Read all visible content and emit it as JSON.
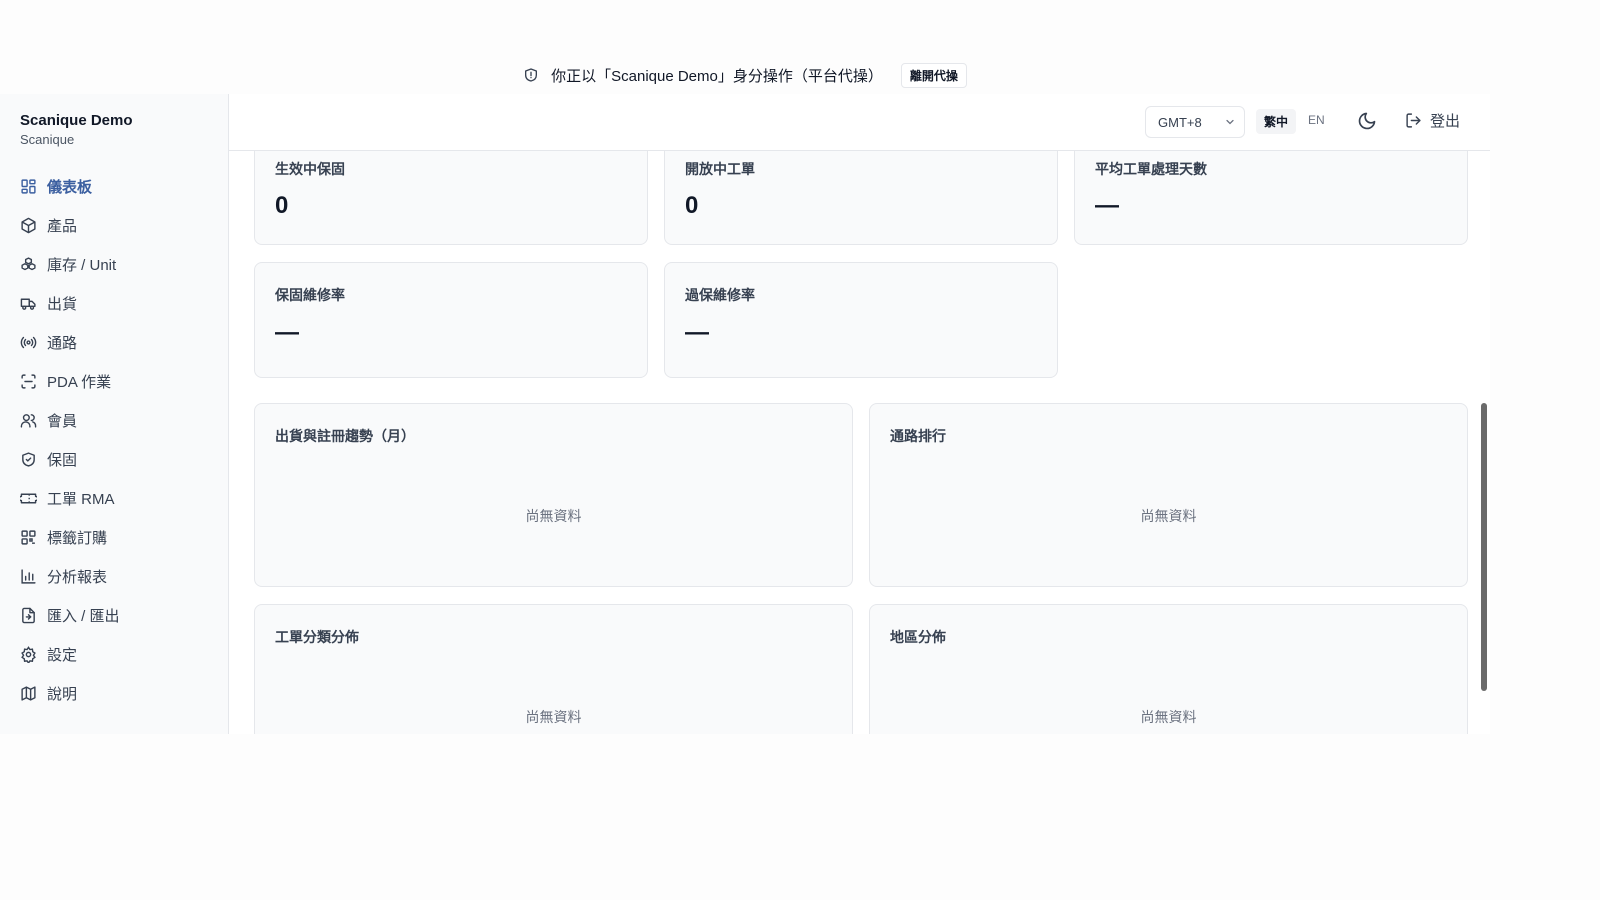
{
  "banner": {
    "text": "你正以「Scanique Demo」身分操作（平台代操）",
    "button_label": "離開代操"
  },
  "sidebar": {
    "brand_name": "Scanique Demo",
    "brand_sub": "Scanique",
    "items": [
      {
        "label": "儀表板",
        "icon": "dashboard-icon"
      },
      {
        "label": "產品",
        "icon": "package-icon"
      },
      {
        "label": "庫存 / Unit",
        "icon": "boxes-icon"
      },
      {
        "label": "出貨",
        "icon": "truck-icon"
      },
      {
        "label": "通路",
        "icon": "radio-icon"
      },
      {
        "label": "PDA 作業",
        "icon": "scan-icon"
      },
      {
        "label": "會員",
        "icon": "users-icon"
      },
      {
        "label": "保固",
        "icon": "shield-check-icon"
      },
      {
        "label": "工單 RMA",
        "icon": "ticket-icon"
      },
      {
        "label": "標籤訂購",
        "icon": "qr-code-icon"
      },
      {
        "label": "分析報表",
        "icon": "bar-chart-icon"
      },
      {
        "label": "匯入 / 匯出",
        "icon": "file-transfer-icon"
      },
      {
        "label": "設定",
        "icon": "gear-icon"
      },
      {
        "label": "說明",
        "icon": "map-icon"
      }
    ]
  },
  "topbar": {
    "timezone": "GMT+8",
    "lang_zh": "繁中",
    "lang_en": "EN",
    "logout_label": "登出"
  },
  "stats": {
    "active_warranty": {
      "title": "生效中保固",
      "value": "0"
    },
    "open_tickets": {
      "title": "開放中工單",
      "value": "0"
    },
    "avg_days": {
      "title": "平均工單處理天數",
      "value": "—"
    },
    "warranty_repair_rate": {
      "title": "保固維修率",
      "value": "—"
    },
    "out_of_warranty_rate": {
      "title": "過保維修率",
      "value": "—"
    }
  },
  "panels": {
    "trend": {
      "title": "出貨與註冊趨勢（月）",
      "empty": "尚無資料"
    },
    "channel_rank": {
      "title": "通路排行",
      "empty": "尚無資料"
    },
    "ticket_category": {
      "title": "工單分類分佈",
      "empty": "尚無資料"
    },
    "region": {
      "title": "地區分佈",
      "empty": "尚無資料"
    }
  },
  "colors": {
    "active_nav": "#3b5fa0",
    "card_bg": "#f9fafb",
    "border": "#e5e7eb"
  }
}
